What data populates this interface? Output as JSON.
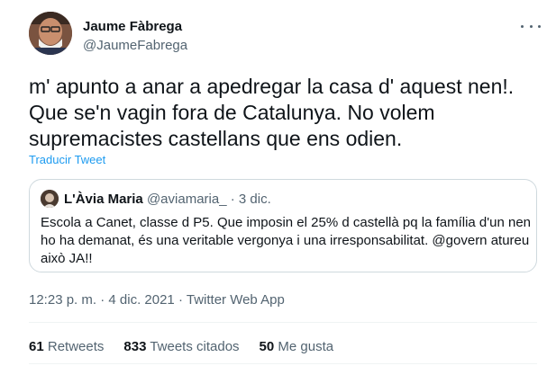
{
  "author": {
    "name": "Jaume Fàbrega",
    "handle": "@JaumeFabrega"
  },
  "tweet": {
    "lines": [
      "m' apunto a anar a apedregar la casa d' aquest nen!.",
      "Que se'n vagin fora de Catalunya. No volem",
      "supremacistes castellans que ens odien."
    ],
    "translate_label": "Traducir Tweet"
  },
  "quoted": {
    "name": "L'Àvia Maria",
    "handle": "@aviamaria_",
    "separator": "·",
    "date": "3 dic.",
    "lines": [
      "Escola a Canet, classe d P5. Que imposin el 25% d castellà pq la família d'un nen",
      "ho ha demanat, és una veritable vergonya i una irresponsabilitat. @govern atureu",
      "això JA!!"
    ]
  },
  "meta": {
    "time": "12:23 p. m.",
    "separator": "·",
    "date": "4 dic. 2021",
    "source": "Twitter Web App"
  },
  "stats": {
    "retweets": {
      "count": "61",
      "label": "Retweets"
    },
    "quotes": {
      "count": "833",
      "label": "Tweets citados"
    },
    "likes": {
      "count": "50",
      "label": "Me gusta"
    }
  },
  "icons": {
    "more": "more-horizontal-icon"
  }
}
